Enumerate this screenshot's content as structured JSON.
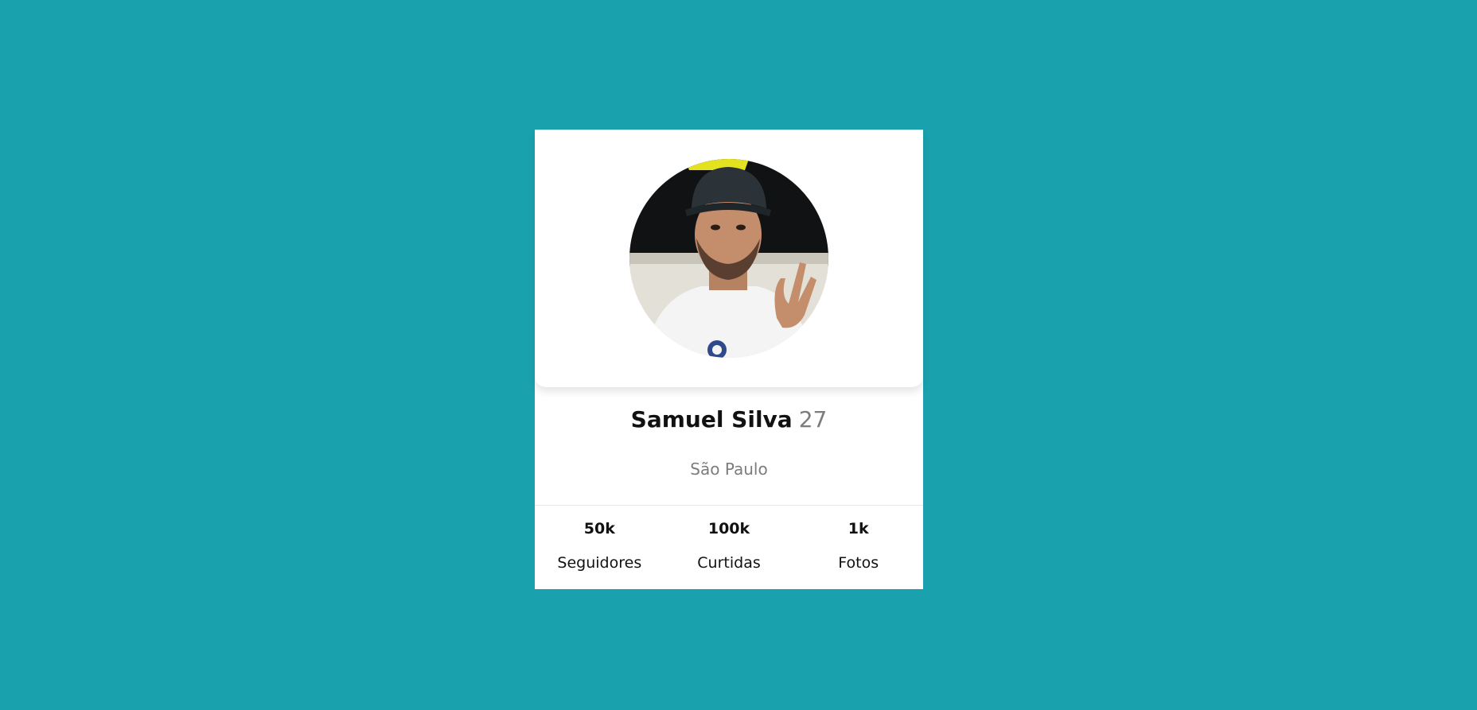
{
  "profile": {
    "name": "Samuel Silva",
    "age": "27",
    "city": "São Paulo",
    "avatar_alt": "profile-photo"
  },
  "stats": [
    {
      "value": "50k",
      "label": "Seguidores"
    },
    {
      "value": "100k",
      "label": "Curtidas"
    },
    {
      "value": "1k",
      "label": "Fotos"
    }
  ],
  "colors": {
    "background": "#1aa1ae",
    "card": "#ffffff",
    "muted_text": "#7c7c7c"
  }
}
